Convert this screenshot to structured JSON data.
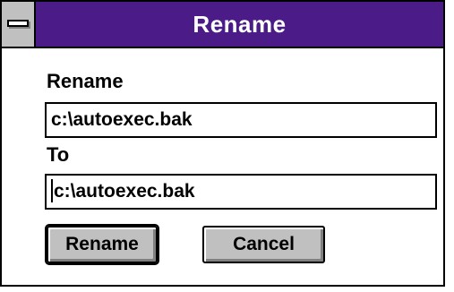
{
  "window": {
    "title": "Rename"
  },
  "form": {
    "from_label": "Rename",
    "from_value": "c:\\autoexec.bak",
    "to_label": "To",
    "to_value": "c:\\autoexec.bak"
  },
  "buttons": {
    "rename_label": "Rename",
    "cancel_label": "Cancel"
  },
  "colors": {
    "titlebar": "#4b1b87",
    "button_face": "#c0c0c0"
  },
  "icons": {
    "system_menu": "system-menu-icon"
  }
}
